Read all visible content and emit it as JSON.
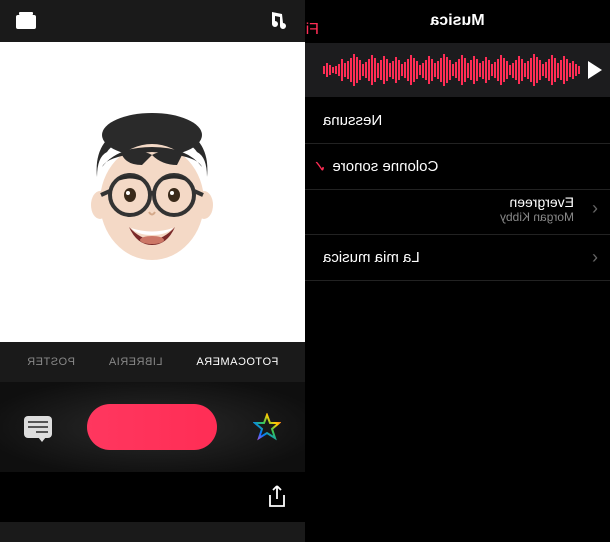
{
  "left": {
    "title": "Musica",
    "done": "Fine",
    "items": {
      "none": "Nessuna",
      "soundtracks": "Colonne sonore",
      "mymusic": "La mia musica"
    },
    "track": {
      "title": "Evergreen",
      "artist": "Morgan Kibby"
    }
  },
  "right": {
    "tabs": {
      "camera": "FOTOCAMERA",
      "library": "LIBRERIA",
      "poster": "POSTER"
    }
  },
  "colors": {
    "accent": "#ff2d55"
  }
}
